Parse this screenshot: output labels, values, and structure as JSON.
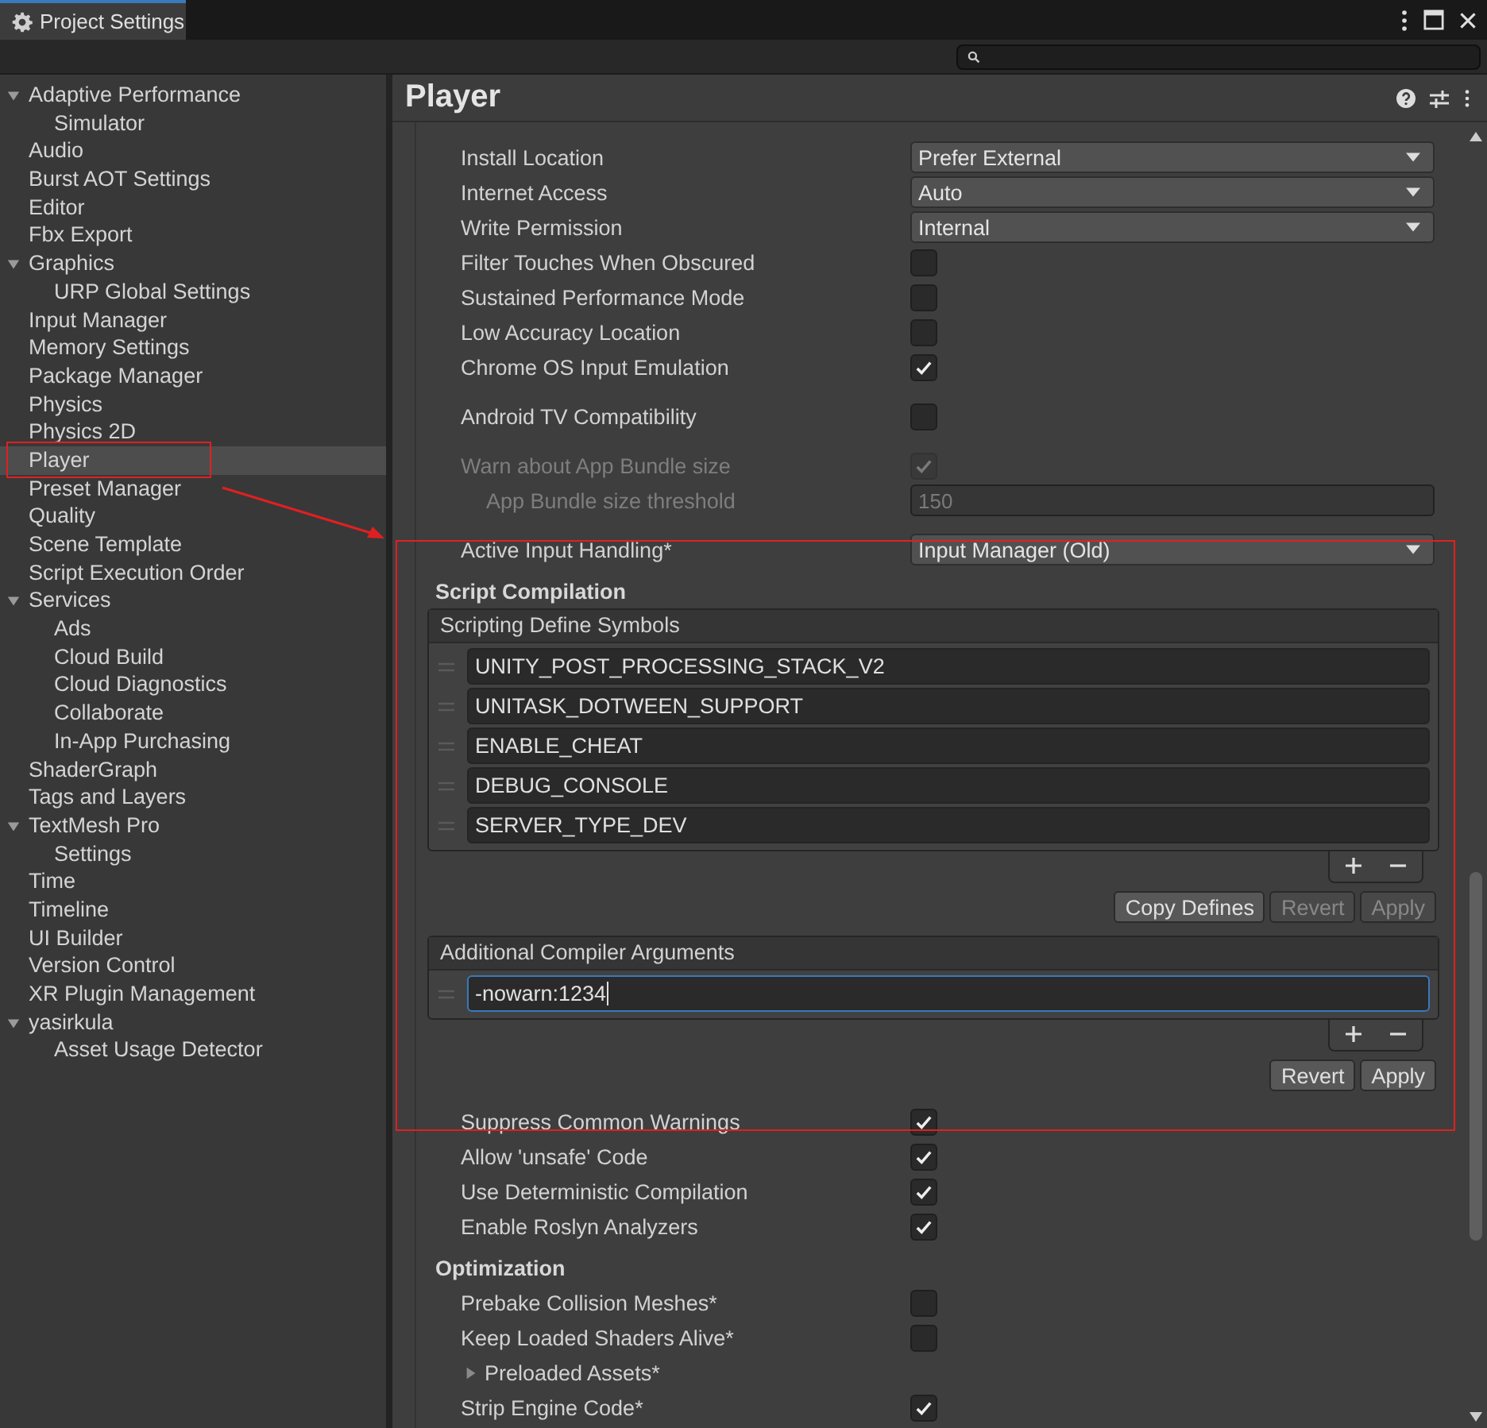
{
  "window": {
    "title": "Project Settings"
  },
  "sidebar": {
    "items": [
      {
        "label": "Adaptive Performance",
        "selected": false,
        "expanded": true,
        "children": [
          {
            "label": "Simulator",
            "selected": false
          }
        ]
      },
      {
        "label": "Audio",
        "selected": false
      },
      {
        "label": "Burst AOT Settings",
        "selected": false
      },
      {
        "label": "Editor",
        "selected": false
      },
      {
        "label": "Fbx Export",
        "selected": false
      },
      {
        "label": "Graphics",
        "selected": false,
        "expanded": true,
        "children": [
          {
            "label": "URP Global Settings",
            "selected": false
          }
        ]
      },
      {
        "label": "Input Manager",
        "selected": false
      },
      {
        "label": "Memory Settings",
        "selected": false
      },
      {
        "label": "Package Manager",
        "selected": false
      },
      {
        "label": "Physics",
        "selected": false
      },
      {
        "label": "Physics 2D",
        "selected": false
      },
      {
        "label": "Player",
        "selected": true
      },
      {
        "label": "Preset Manager",
        "selected": false
      },
      {
        "label": "Quality",
        "selected": false
      },
      {
        "label": "Scene Template",
        "selected": false
      },
      {
        "label": "Script Execution Order",
        "selected": false
      },
      {
        "label": "Services",
        "selected": false,
        "expanded": true,
        "children": [
          {
            "label": "Ads",
            "selected": false
          },
          {
            "label": "Cloud Build",
            "selected": false
          },
          {
            "label": "Cloud Diagnostics",
            "selected": false
          },
          {
            "label": "Collaborate",
            "selected": false
          },
          {
            "label": "In-App Purchasing",
            "selected": false
          }
        ]
      },
      {
        "label": "ShaderGraph",
        "selected": false
      },
      {
        "label": "Tags and Layers",
        "selected": false
      },
      {
        "label": "TextMesh Pro",
        "selected": false,
        "expanded": true,
        "children": [
          {
            "label": "Settings",
            "selected": false
          }
        ]
      },
      {
        "label": "Time",
        "selected": false
      },
      {
        "label": "Timeline",
        "selected": false
      },
      {
        "label": "UI Builder",
        "selected": false
      },
      {
        "label": "Version Control",
        "selected": false
      },
      {
        "label": "XR Plugin Management",
        "selected": false
      },
      {
        "label": "yasirkula",
        "selected": false,
        "expanded": true,
        "children": [
          {
            "label": "Asset Usage Detector",
            "selected": false
          }
        ]
      }
    ]
  },
  "inspector": {
    "title": "Player",
    "groups": [
      {
        "rows": [
          {
            "kind": "dropdown",
            "label": "Install Location",
            "value": "Prefer External"
          },
          {
            "kind": "dropdown",
            "label": "Internet Access",
            "value": "Auto"
          },
          {
            "kind": "dropdown",
            "label": "Write Permission",
            "value": "Internal"
          },
          {
            "kind": "checkbox",
            "label": "Filter Touches When Obscured",
            "checked": false,
            "disabled": false
          },
          {
            "kind": "checkbox",
            "label": "Sustained Performance Mode",
            "checked": false,
            "disabled": false
          },
          {
            "kind": "checkbox",
            "label": "Low Accuracy Location",
            "checked": false,
            "disabled": false
          },
          {
            "kind": "checkbox",
            "label": "Chrome OS Input Emulation",
            "checked": true,
            "disabled": false
          }
        ]
      },
      {
        "rows": [
          {
            "kind": "checkbox",
            "label": "Android TV Compatibility",
            "checked": false,
            "disabled": false
          }
        ]
      },
      {
        "rows": [
          {
            "kind": "checkbox",
            "label": "Warn about App Bundle size",
            "checked": true,
            "disabled": true
          },
          {
            "kind": "number",
            "label": "App Bundle size threshold",
            "value": "150",
            "disabled": true,
            "indented": true
          }
        ]
      },
      {
        "rows": [
          {
            "kind": "dropdown",
            "label": "Active Input Handling*",
            "value": "Input Manager (Old)"
          },
          {
            "kind": "heading",
            "label": "Script Compilation"
          },
          {
            "kind": "list",
            "header": "Scripting Define Symbols",
            "items": [
              {
                "value": "UNITY_POST_PROCESSING_STACK_V2",
                "focused": false
              },
              {
                "value": "UNITASK_DOTWEEN_SUPPORT",
                "focused": false
              },
              {
                "value": "ENABLE_CHEAT",
                "focused": false
              },
              {
                "value": "DEBUG_CONSOLE",
                "focused": false
              },
              {
                "value": "SERVER_TYPE_DEV",
                "focused": false
              }
            ],
            "buttons": [
              {
                "label": "Copy Defines",
                "disabled": false
              },
              {
                "label": "Revert",
                "disabled": true
              },
              {
                "label": "Apply",
                "disabled": true
              }
            ]
          },
          {
            "kind": "list",
            "header": "Additional Compiler Arguments",
            "items": [
              {
                "value": "-nowarn:1234",
                "focused": true
              }
            ],
            "buttons": [
              {
                "label": "Revert",
                "disabled": false
              },
              {
                "label": "Apply",
                "disabled": false
              }
            ]
          },
          {
            "kind": "checkbox",
            "label": "Suppress Common Warnings",
            "checked": true,
            "disabled": false
          },
          {
            "kind": "checkbox",
            "label": "Allow 'unsafe' Code",
            "checked": true,
            "disabled": false
          },
          {
            "kind": "checkbox",
            "label": "Use Deterministic Compilation",
            "checked": true,
            "disabled": false
          },
          {
            "kind": "checkbox",
            "label": "Enable Roslyn Analyzers",
            "checked": true,
            "disabled": false
          },
          {
            "kind": "heading",
            "label": "Optimization"
          },
          {
            "kind": "checkbox",
            "label": "Prebake Collision Meshes*",
            "checked": false,
            "disabled": false
          },
          {
            "kind": "checkbox",
            "label": "Keep Loaded Shaders Alive*",
            "checked": false,
            "disabled": false
          },
          {
            "kind": "foldout",
            "label": "Preloaded Assets*",
            "expanded": false
          },
          {
            "kind": "checkbox",
            "label": "Strip Engine Code*",
            "checked": true,
            "disabled": false
          }
        ]
      }
    ]
  }
}
